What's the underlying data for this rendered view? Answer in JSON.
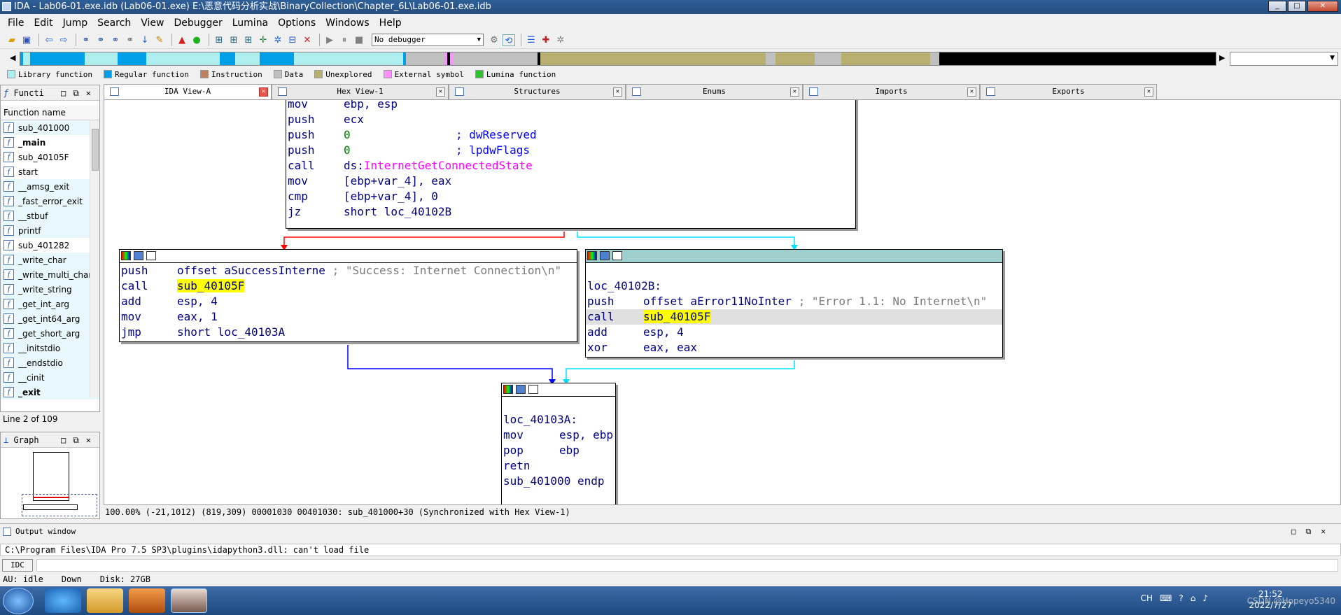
{
  "window": {
    "title": "IDA - Lab06-01.exe.idb (Lab06-01.exe) E:\\恶意代码分析实战\\BinaryCollection\\Chapter_6L\\Lab06-01.exe.idb"
  },
  "menu": [
    "File",
    "Edit",
    "Jump",
    "Search",
    "View",
    "Debugger",
    "Lumina",
    "Options",
    "Windows",
    "Help"
  ],
  "toolbar": {
    "debugger_value": "No debugger"
  },
  "legend": [
    {
      "label": "Library function",
      "color": "#aeeeee"
    },
    {
      "label": "Regular function",
      "color": "#00a0e8"
    },
    {
      "label": "Instruction",
      "color": "#c08060"
    },
    {
      "label": "Data",
      "color": "#c0c0c0"
    },
    {
      "label": "Unexplored",
      "color": "#b8b070"
    },
    {
      "label": "External symbol",
      "color": "#ff90ff"
    },
    {
      "label": "Lumina function",
      "color": "#30c030"
    }
  ],
  "functions": {
    "title": "Functi",
    "column": "Function name",
    "items": [
      "sub_401000",
      "_main",
      "sub_40105F",
      "start",
      "__amsg_exit",
      "_fast_error_exit",
      "__stbuf",
      "printf",
      "sub_401282",
      "_write_char",
      "_write_multi_char",
      "_write_string",
      "_get_int_arg",
      "_get_int64_arg",
      "_get_short_arg",
      "__initstdio",
      "__endstdio",
      "__cinit",
      "_exit"
    ],
    "status": "Line 2 of 109"
  },
  "graph_panel": {
    "title": "Graph"
  },
  "tabs": [
    "IDA View-A",
    "Hex View-1",
    "Structures",
    "Enums",
    "Imports",
    "Exports"
  ],
  "nodes": {
    "top": [
      {
        "m": "mov",
        "o": "ebp, esp"
      },
      {
        "m": "push",
        "o": "ecx"
      },
      {
        "m": "push",
        "o": "0",
        "cm": "; dwReserved"
      },
      {
        "m": "push",
        "o": "0",
        "cm": "; lpdwFlags"
      },
      {
        "m": "call",
        "o": "ds:",
        "api": "InternetGetConnectedState"
      },
      {
        "m": "mov",
        "o": "[ebp+var_4], eax"
      },
      {
        "m": "cmp",
        "o": "[ebp+var_4], 0"
      },
      {
        "m": "jz",
        "o": "short loc_40102B"
      }
    ],
    "left": [
      {
        "m": "push",
        "o": "offset aSuccessInterne",
        "cm": "; \"Success: Internet Connection\\n\""
      },
      {
        "m": "call",
        "o": "sub_40105F"
      },
      {
        "m": "add",
        "o": "esp, 4"
      },
      {
        "m": "mov",
        "o": "eax, 1"
      },
      {
        "m": "jmp",
        "o": "short loc_40103A"
      }
    ],
    "right_label": "loc_40102B:",
    "right": [
      {
        "m": "push",
        "o": "offset aError11NoInter",
        "cm": "; \"Error 1.1: No Internet\\n\""
      },
      {
        "m": "call",
        "o": "sub_40105F"
      },
      {
        "m": "add",
        "o": "esp, 4"
      },
      {
        "m": "xor",
        "o": "eax, eax"
      }
    ],
    "bottom_label": "loc_40103A:",
    "bottom": [
      {
        "m": "mov",
        "o": "esp, ebp"
      },
      {
        "m": "pop",
        "o": "ebp"
      },
      {
        "m": "retn",
        "o": ""
      }
    ],
    "bottom_end": "sub_401000 endp"
  },
  "graph_status": "100.00% (-21,1012) (819,309) 00001030 00401030: sub_401000+30 (Synchronized with Hex View-1)",
  "output": {
    "title": "Output window",
    "text": "C:\\Program Files\\IDA Pro 7.5 SP3\\plugins\\idapython3.dll: can't load file",
    "idc_label": "IDC"
  },
  "status": {
    "au": "AU:  idle",
    "dir": "Down",
    "disk": "Disk: 27GB"
  },
  "taskbar": {
    "lang": "CH",
    "time": "21:52",
    "date": "2022/7/27",
    "watermark": "CSDN @Hopeyo5340"
  }
}
